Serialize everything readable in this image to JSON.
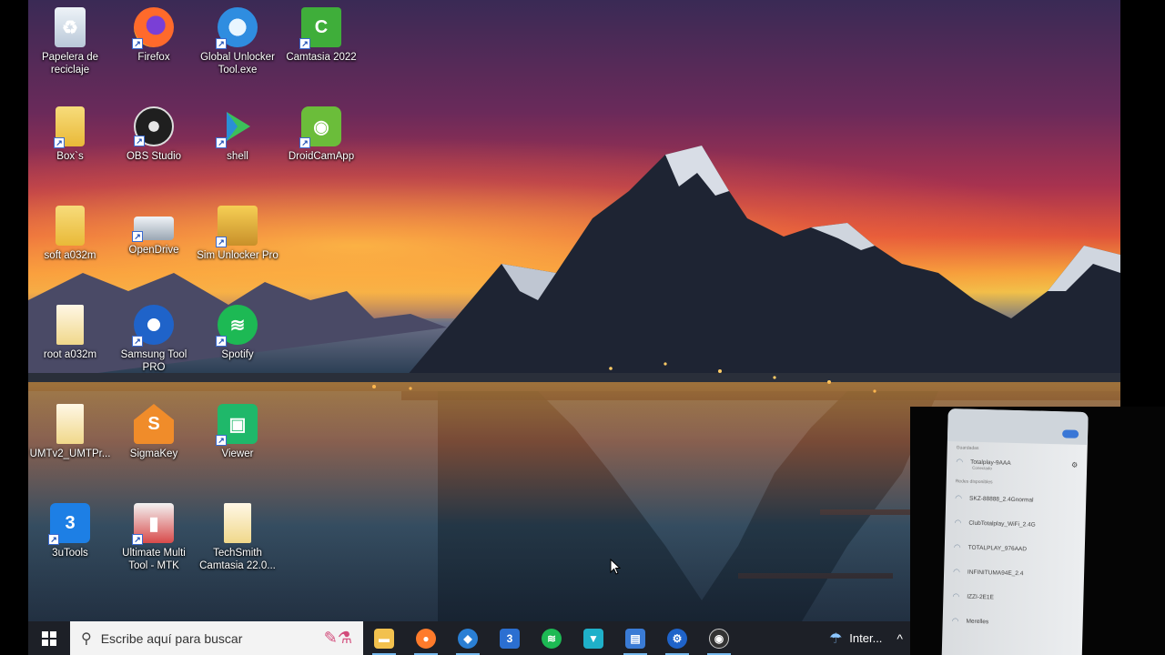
{
  "desktop": {
    "icons": [
      {
        "label": "Papelera de reciclaje",
        "icon": "recycle-bin-icon"
      },
      {
        "label": "Firefox",
        "icon": "firefox-icon"
      },
      {
        "label": "Global Unlocker Tool.exe",
        "icon": "global-unlocker-icon"
      },
      {
        "label": "Camtasia 2022",
        "icon": "camtasia-icon"
      },
      {
        "label": "Box`s",
        "icon": "folder-icon"
      },
      {
        "label": "OBS Studio",
        "icon": "obs-icon"
      },
      {
        "label": "shell",
        "icon": "shell-icon"
      },
      {
        "label": "DroidCamApp",
        "icon": "droidcam-icon"
      },
      {
        "label": "soft a032m",
        "icon": "folder-icon"
      },
      {
        "label": "OpenDrive",
        "icon": "opendrive-icon"
      },
      {
        "label": "Sim Unlocker Pro",
        "icon": "sim-unlocker-icon"
      },
      {
        "label": "root a032m",
        "icon": "folder-icon"
      },
      {
        "label": "Samsung Tool PRO",
        "icon": "samsung-tool-icon"
      },
      {
        "label": "Spotify",
        "icon": "spotify-icon"
      },
      {
        "label": "UMTv2_UMTPr...",
        "icon": "umt-icon"
      },
      {
        "label": "SigmaKey",
        "icon": "sigmakey-icon"
      },
      {
        "label": "Viewer",
        "icon": "viewer-icon"
      },
      {
        "label": "3uTools",
        "icon": "3utools-icon"
      },
      {
        "label": "Ultimate Multi Tool - MTK",
        "icon": "ultimate-multi-tool-icon"
      },
      {
        "label": "TechSmith Camtasia 22.0...",
        "icon": "document-icon"
      }
    ]
  },
  "taskbar": {
    "search_placeholder": "Escribe aquí para buscar",
    "apps": [
      {
        "name": "file-explorer",
        "icon": "folder-icon",
        "color": "#f2c14e",
        "glyph": "▬"
      },
      {
        "name": "firefox",
        "icon": "firefox-icon",
        "color": "#ff7b2b",
        "glyph": "●"
      },
      {
        "name": "app-blue",
        "icon": "app-icon",
        "color": "#2a7fd4",
        "glyph": "◆"
      },
      {
        "name": "app-3u",
        "icon": "3utools-icon",
        "color": "#2b6fd1",
        "glyph": "3"
      },
      {
        "name": "spotify",
        "icon": "spotify-icon",
        "color": "#1db954",
        "glyph": "≋"
      },
      {
        "name": "app-teal",
        "icon": "shield-icon",
        "color": "#1fb0c9",
        "glyph": "▼"
      },
      {
        "name": "app-monitor",
        "icon": "monitor-icon",
        "color": "#3a7bd5",
        "glyph": "▤"
      },
      {
        "name": "samsung-tool",
        "icon": "gear-icon",
        "color": "#1f63c9",
        "glyph": "⚙"
      },
      {
        "name": "obs",
        "icon": "obs-icon",
        "color": "#333333",
        "glyph": "◉"
      }
    ],
    "tray_label": "Inter...",
    "chevron": "^"
  },
  "phone": {
    "saved_label": "Guardadas",
    "connected_network": "Totalplay-9AAA",
    "connected_status": "Conectado",
    "available_label": "Redes disponibles",
    "networks": [
      "SKZ-88888_2.4Gnormal",
      "ClubTotalplay_WiFi_2.4G",
      "TOTALPLAY_976AAD",
      "INFINITUMA94E_2.4",
      "IZZI-2E1E",
      "Merelles"
    ]
  },
  "colors": {
    "taskbar_bg": "#1d2027",
    "search_bg": "#f3f3f3",
    "accent": "#76b9ed"
  }
}
